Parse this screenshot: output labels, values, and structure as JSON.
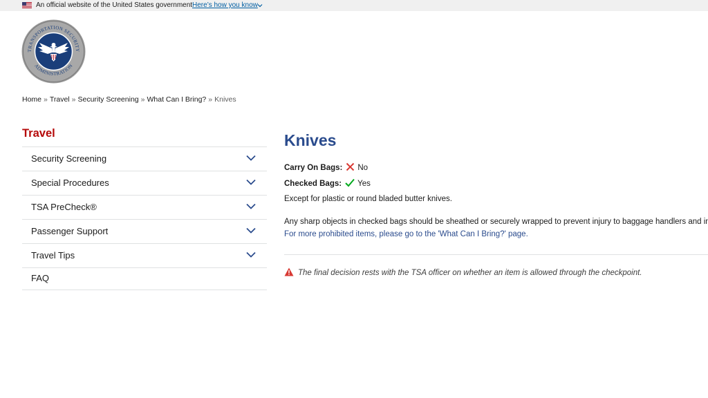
{
  "gov_banner": {
    "official_text": "An official website of the United States government",
    "how_you_know": "Here’s how you know"
  },
  "logo": {
    "ring_text_top": "TRANSPORTATION SECURITY",
    "ring_text_bottom": "ADMINISTRATION"
  },
  "breadcrumb": {
    "items": [
      "Home",
      "Travel",
      "Security Screening",
      "What Can I Bring?"
    ],
    "separator": "»",
    "current": "Knives"
  },
  "sidebar": {
    "title": "Travel",
    "items": [
      {
        "label": "Security Screening",
        "expandable": true
      },
      {
        "label": "Special Procedures",
        "expandable": true
      },
      {
        "label": "TSA PreCheck®",
        "expandable": true
      },
      {
        "label": "Passenger Support",
        "expandable": true
      },
      {
        "label": "Travel Tips",
        "expandable": true
      },
      {
        "label": "FAQ",
        "expandable": false
      }
    ]
  },
  "main": {
    "title": "Knives",
    "carry_on_label": "Carry On Bags:",
    "carry_on_value": "No",
    "checked_label": "Checked Bags:",
    "checked_value": "Yes",
    "note": "Except for plastic or round bladed butter knives.",
    "paragraph": "Any sharp objects in checked bags should be sheathed or securely wrapped to prevent injury to baggage handlers and inspectors.",
    "link_text": "For more prohibited items, please go to the 'What Can I Bring?' page.",
    "warning": "The final decision rests with the TSA officer on whether an item is allowed through the checkpoint."
  },
  "colors": {
    "sidebar_title": "#b50909",
    "heading": "#2a4b8d",
    "no_icon": "#d83933",
    "yes_icon": "#00a91c",
    "warning_icon": "#d83933",
    "seal_blue": "#1a3e7a"
  }
}
